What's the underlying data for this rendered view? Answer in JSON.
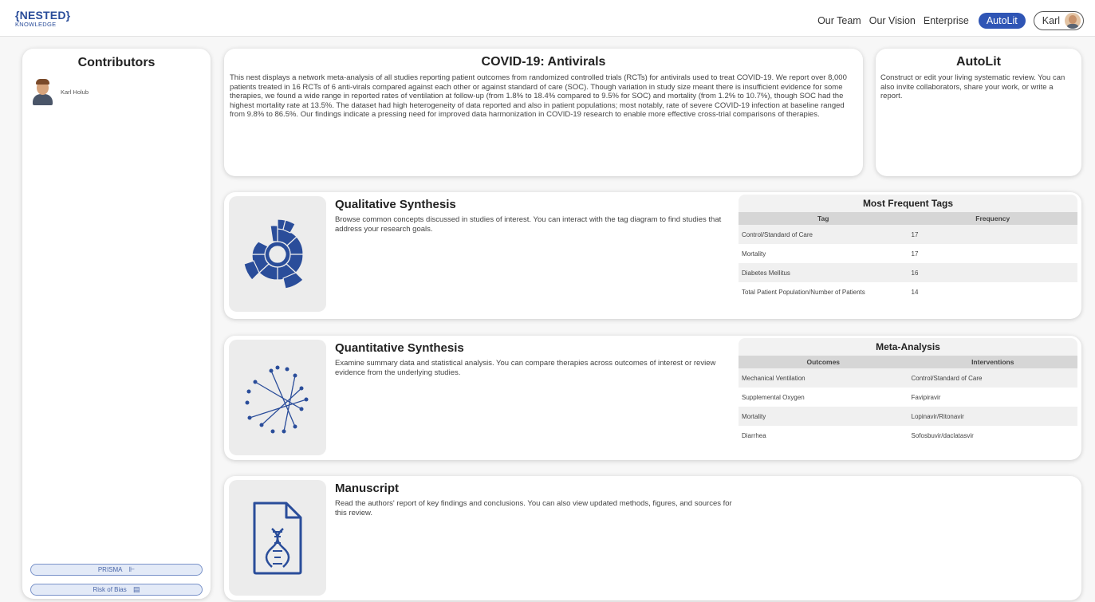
{
  "header": {
    "logo_top": "{NESTED}",
    "logo_bottom": "KNOWLEDGE",
    "nav": [
      "Our Team",
      "Our Vision",
      "Enterprise"
    ],
    "autolit_label": "AutoLit",
    "user_name": "Karl"
  },
  "contributors": {
    "title": "Contributors",
    "people": [
      {
        "name": "Karl Holub"
      }
    ],
    "prisma_label": "PRISMA",
    "risk_label": "Risk of Bias"
  },
  "description": {
    "title": "COVID-19: Antivirals",
    "text": "This nest displays a network meta-analysis of all studies reporting patient outcomes from randomized controlled trials (RCTs) for antivirals used to treat COVID-19. We report over 8,000 patients treated in 16 RCTs of 6 anti-virals compared against each other or against standard of care (SOC). Though variation in study size meant there is insufficient evidence for some therapies, we found a wide range in reported rates of ventilation at follow-up (from 1.8% to 18.4% compared to 9.5% for SOC) and mortality (from 1.2% to 10.7%), though SOC had the highest mortality rate at 13.5%. The dataset had high heterogeneity of data reported and also in patient populations; most notably, rate of severe COVID-19 infection at baseline ranged from 9.8% to 86.5%. Our findings indicate a pressing need for improved data harmonization in COVID-19 research to enable more effective cross-trial comparisons of therapies."
  },
  "autolit": {
    "title": "AutoLit",
    "text": "Construct or edit your living systematic review. You can also invite collaborators, share your work, or write a report."
  },
  "qualitative": {
    "title": "Qualitative Synthesis",
    "text": "Browse common concepts discussed in studies of interest. You can interact with the tag diagram to find studies that address your research goals.",
    "table_title": "Most Frequent Tags",
    "columns": [
      "Tag",
      "Frequency"
    ],
    "rows": [
      {
        "tag": "Control/Standard of Care",
        "freq": "17"
      },
      {
        "tag": "Mortality",
        "freq": "17"
      },
      {
        "tag": "Diabetes Mellitus",
        "freq": "16"
      },
      {
        "tag": "Total Patient Population/Number of Patients",
        "freq": "14"
      }
    ]
  },
  "quantitative": {
    "title": "Quantitative Synthesis",
    "text": "Examine summary data and statistical analysis. You can compare therapies across outcomes of interest or review evidence from the underlying studies.",
    "table_title": "Meta-Analysis",
    "columns": [
      "Outcomes",
      "Interventions"
    ],
    "rows": [
      {
        "outcome": "Mechanical Ventilation",
        "intervention": "Control/Standard of Care"
      },
      {
        "outcome": "Supplemental Oxygen",
        "intervention": "Favipiravir"
      },
      {
        "outcome": "Mortality",
        "intervention": "Lopinavir/Ritonavir"
      },
      {
        "outcome": "Diarrhea",
        "intervention": "Sofosbuvir/daclatasvir"
      }
    ]
  },
  "manuscript": {
    "title": "Manuscript",
    "text": "Read the authors' report of key findings and conclusions. You can also view updated methods, figures, and sources for this review."
  },
  "icons": {
    "sunburst": "sunburst-chart-icon",
    "network": "network-graph-icon",
    "document": "dna-document-icon",
    "prisma": "flowchart-icon",
    "risk": "clipboard-icon"
  },
  "colors": {
    "accent": "#2f55b5",
    "icon_blue": "#2a4d9a"
  }
}
